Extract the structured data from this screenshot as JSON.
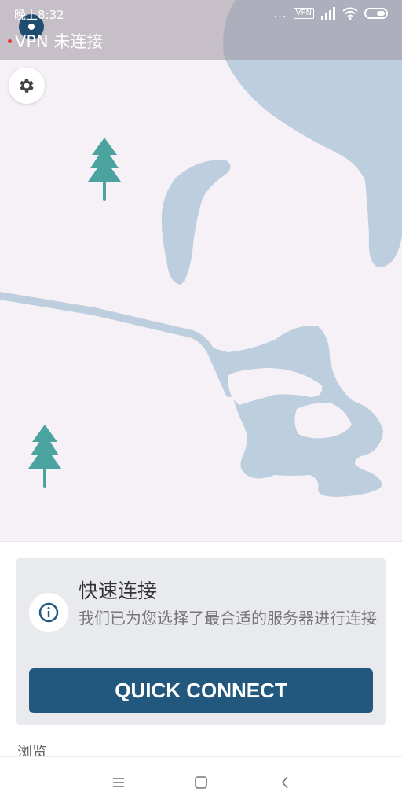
{
  "status_bar": {
    "time": "晚上8:32",
    "dots": "...",
    "vpn_badge": "VPN",
    "vpn_status": "VPN 未连接"
  },
  "map": {
    "water_color": "#bdcfdf",
    "land_color": "#f6f1f6",
    "tree_color": "#4aa39e"
  },
  "quick_connect": {
    "title": "快速连接",
    "description": "我们已为您选择了最合适的服务器进行连接",
    "button_label": "QUICK CONNECT",
    "accent_color": "#22577e"
  },
  "browse_label": "浏览",
  "icons": {
    "settings": "gear-icon",
    "info": "info-icon",
    "nav_menu": "menu-icon",
    "nav_home": "square-home-icon",
    "nav_back": "back-chevron-icon"
  }
}
